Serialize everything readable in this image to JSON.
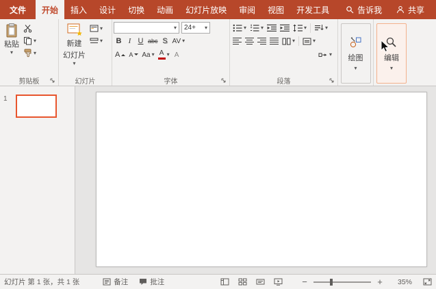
{
  "colors": {
    "brand": "#B7472A",
    "active_tab_text": "#C0492C",
    "ribbon_bg": "#F3F2F1",
    "canvas_bg": "#E6E5E4",
    "selection_border": "#E8552D",
    "font_color_swatch": "#C00000"
  },
  "icons": {
    "dropdown": "▾",
    "zoom_out": "−",
    "zoom_in": "+"
  },
  "titlebar": {
    "file": "文件",
    "tabs": [
      "开始",
      "插入",
      "设计",
      "切换",
      "动画",
      "幻灯片放映",
      "审阅",
      "视图",
      "开发工具"
    ],
    "active_tab": "开始",
    "tell_me": "告诉我",
    "share": "共享"
  },
  "ribbon": {
    "clipboard": {
      "group_label": "剪贴板",
      "paste_label": "粘贴"
    },
    "slides": {
      "group_label": "幻灯片",
      "new_slide_line1": "新建",
      "new_slide_line2": "幻灯片"
    },
    "font": {
      "group_label": "字体",
      "font_name": "",
      "font_size": "24+",
      "bold": "B",
      "italic": "I",
      "underline": "U",
      "strikethrough": "abc",
      "shadow": "S",
      "char_spacing": "AV",
      "change_case": "Aa",
      "font_color": "A",
      "grow_font": "A",
      "shrink_font": "A",
      "clear_format": "A"
    },
    "paragraph": {
      "group_label": "段落"
    },
    "drawing": {
      "button_label": "绘图"
    },
    "editing": {
      "button_label": "编辑"
    }
  },
  "slides_panel": {
    "slide_number": "1"
  },
  "statusbar": {
    "slide_counter": "幻灯片 第 1 张，共 1 张",
    "notes_label": "备注",
    "comments_label": "批注",
    "zoom_value": "35%"
  }
}
